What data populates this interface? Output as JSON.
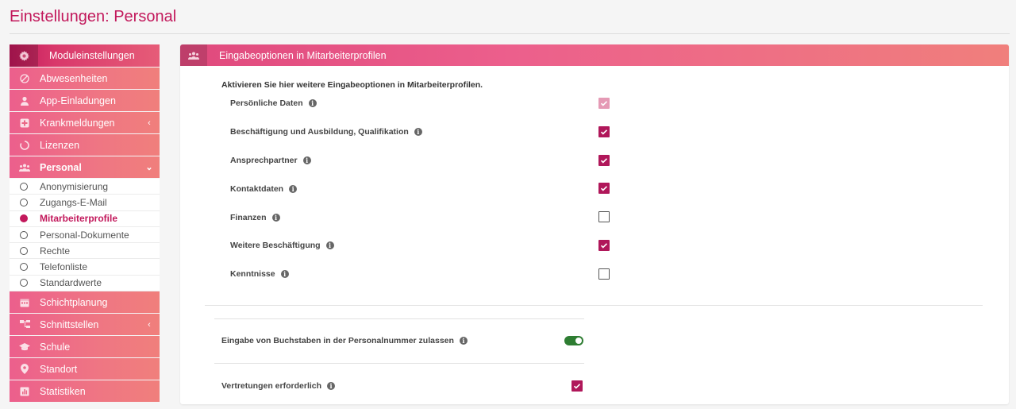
{
  "page": {
    "title": "Einstellungen: Personal"
  },
  "sidebar": {
    "header": {
      "label": "Moduleinstellungen",
      "icon": "gear-icon"
    },
    "items": [
      {
        "label": "Abwesenheiten",
        "icon": "prohibited-icon"
      },
      {
        "label": "App-Einladungen",
        "icon": "person-icon"
      },
      {
        "label": "Krankmeldungen",
        "icon": "medical-plus-icon",
        "chevron": "‹"
      },
      {
        "label": "Lizenzen",
        "icon": "circle-notch-icon"
      },
      {
        "label": "Personal",
        "icon": "users-icon",
        "chevron": "⌄"
      }
    ],
    "sub_items": [
      "Anonymisierung",
      "Zugangs-E-Mail",
      "Mitarbeiterprofile",
      "Personal-Dokumente",
      "Rechte",
      "Telefonliste",
      "Standardwerte"
    ],
    "active_sub": "Mitarbeiterprofile",
    "items_after": [
      {
        "label": "Schichtplanung",
        "icon": "calendar-icon"
      },
      {
        "label": "Schnittstellen",
        "icon": "sitemap-icon",
        "chevron": "‹"
      },
      {
        "label": "Schule",
        "icon": "graduation-cap-icon"
      },
      {
        "label": "Standort",
        "icon": "map-pin-icon"
      },
      {
        "label": "Statistiken",
        "icon": "chart-icon"
      }
    ]
  },
  "panel": {
    "title": "Eingabeoptionen in Mitarbeiterprofilen",
    "icon": "users-icon",
    "intro": "Aktivieren Sie hier weitere Eingabeoptionen in Mitarbeiterprofilen.",
    "options": [
      {
        "label": "Persönliche Daten",
        "state": "checked-disabled"
      },
      {
        "label": "Beschäftigung und Ausbildung, Qualifikation",
        "state": "checked"
      },
      {
        "label": "Ansprechpartner",
        "state": "checked"
      },
      {
        "label": "Kontaktdaten",
        "state": "checked"
      },
      {
        "label": "Finanzen",
        "state": "unchecked"
      },
      {
        "label": "Weitere Beschäftigung",
        "state": "checked"
      },
      {
        "label": "Kenntnisse",
        "state": "unchecked"
      }
    ],
    "letters_in_number": {
      "label": "Eingabe von Buchstaben in der Personalnummer zulassen",
      "enabled": true
    },
    "substitutes_required": {
      "label": "Vertretungen erforderlich",
      "checked": true
    }
  },
  "colors": {
    "accent": "#c2185b",
    "checkbox": "#b0175a",
    "toggle_on": "#2e7d32"
  }
}
